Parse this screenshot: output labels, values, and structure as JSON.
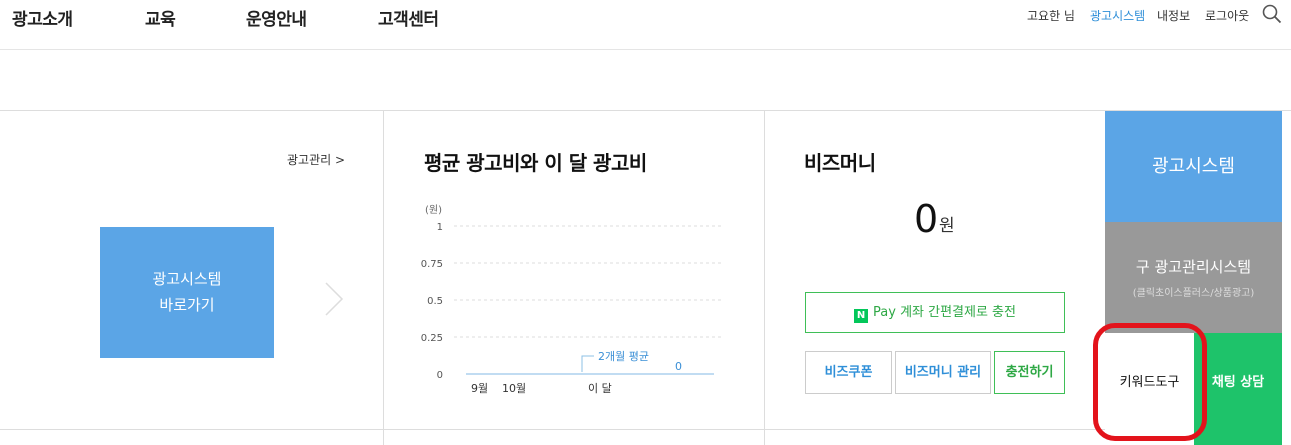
{
  "nav": {
    "items": [
      "광고소개",
      "교육",
      "운영안내",
      "고객센터"
    ],
    "user": "고요한 님",
    "ad_system": "광고시스템",
    "my_info": "내정보",
    "logout": "로그아웃",
    "search_icon": "search-icon"
  },
  "left_panel": {
    "ad_manage_link": "광고관리 >",
    "shortcut_line1": "광고시스템",
    "shortcut_line2": "바로가기"
  },
  "chart_panel": {
    "title": "평균 광고비와 이 달 광고비",
    "chart_data": {
      "type": "line",
      "ylabel": "(원)",
      "y_ticks": [
        "1",
        "0.75",
        "0.5",
        "0.25",
        "0"
      ],
      "ylim": [
        0,
        1
      ],
      "x_labels": [
        "9월",
        "10월",
        "이 달"
      ],
      "series": [
        {
          "name": "2개월 평균",
          "values": [
            0,
            0,
            0
          ]
        }
      ],
      "annotations": {
        "average_label": "2개월 평균",
        "current_value": "0"
      },
      "grid": true
    }
  },
  "bizmoney_panel": {
    "title": "비즈머니",
    "value": "0",
    "unit": "원",
    "npay_label": "Pay 계좌 간편결제로 충전",
    "npay_logo": "N",
    "coupon": "비즈쿠폰",
    "manage": "비즈머니 관리",
    "charge": "충전하기"
  },
  "side_menu": {
    "ad_system": "광고시스템",
    "old_system": "구 광고관리시스템",
    "old_system_sub": "(클릭초이스플러스/상품광고)",
    "keyword_tool": "키워드도구",
    "chat": "채팅 상담"
  },
  "colors": {
    "blue": "#5ba5e6",
    "gray": "#999999",
    "green": "#1ec36a",
    "highlight_ring": "#e3131b"
  }
}
